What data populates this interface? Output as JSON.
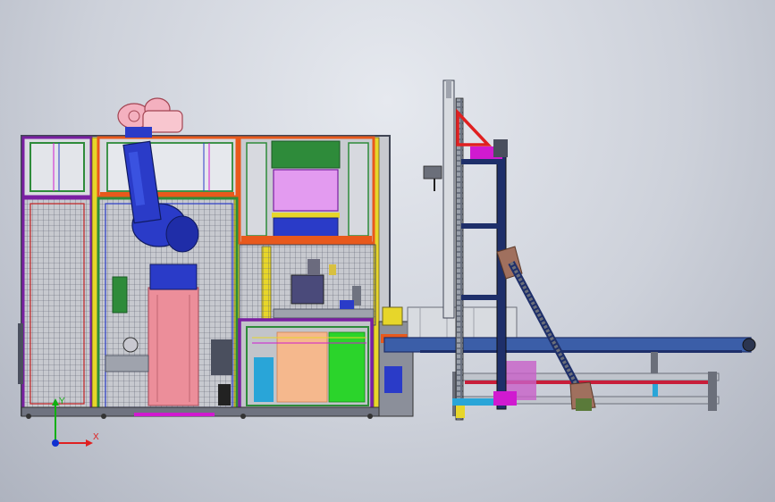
{
  "viewport": {
    "background_top": "#e6e9ef",
    "background_bottom": "#aeb3bf"
  },
  "triad": {
    "x_label": "X",
    "y_label": "Y",
    "x_color": "#e02020",
    "y_color": "#10b010",
    "z_color": "#1030d0"
  },
  "palette": {
    "frame_purple": "#7a1fa2",
    "frame_orange": "#e8591c",
    "frame_green": "#2e8b3a",
    "frame_yellow": "#e7d62a",
    "robot_blue": "#2a3bc8",
    "pedestal_pink": "#ec8e9a",
    "conveyor_blue": "#3b5ea8",
    "tower_navy": "#1e2f6a",
    "magenta": "#d01ad0"
  },
  "model": {
    "name_hint": "",
    "parts": [
      "robot-cell",
      "robot-arm",
      "safety-fence",
      "pallet-station",
      "conveyor",
      "lift-tower",
      "inclined-chain"
    ]
  }
}
